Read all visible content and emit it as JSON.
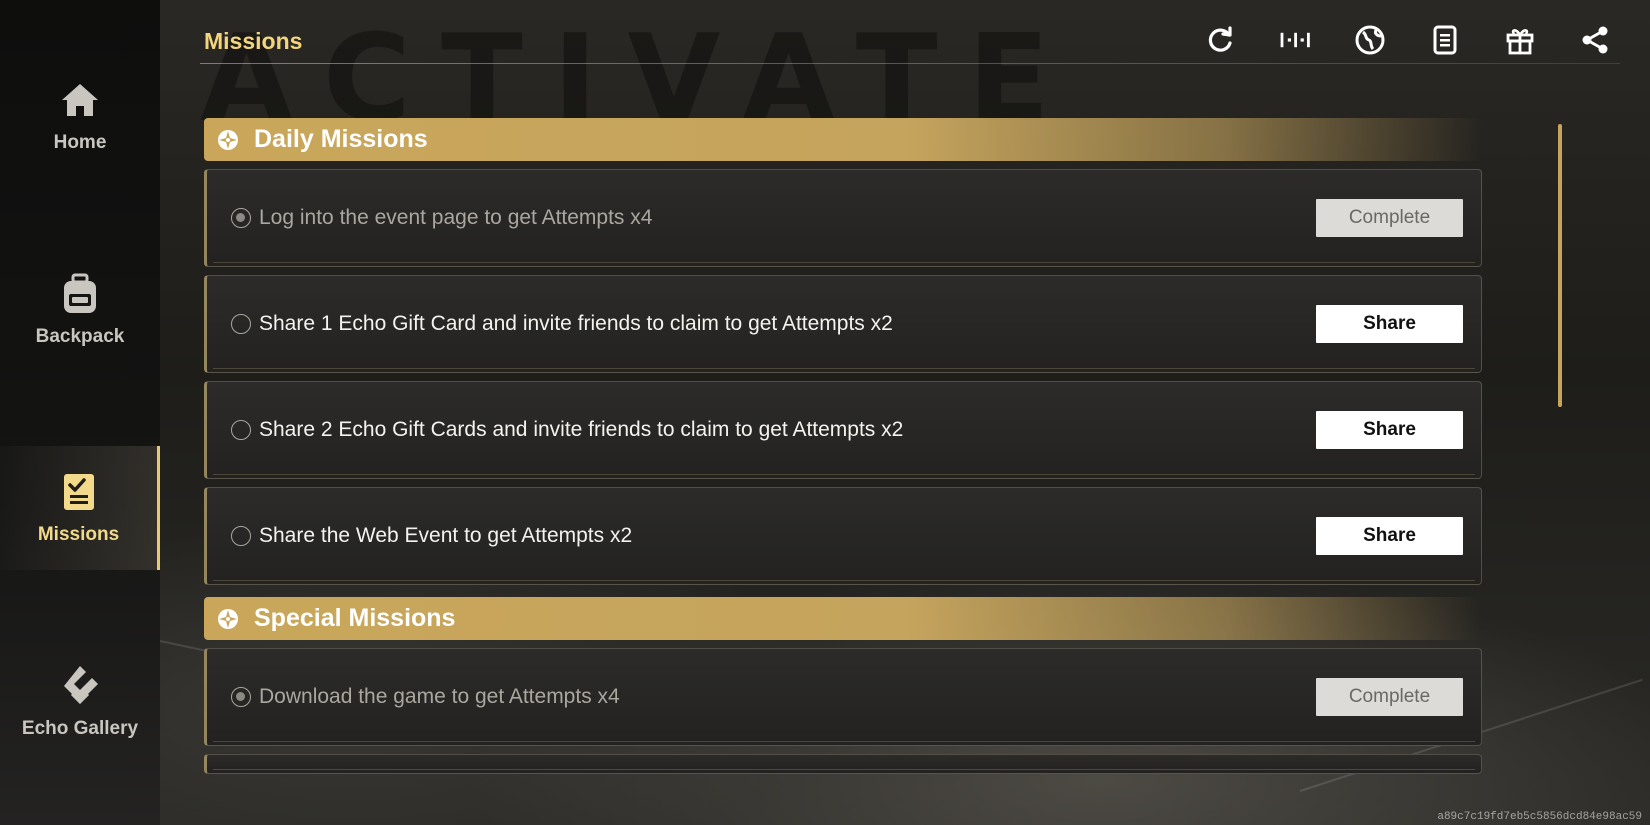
{
  "header": {
    "title": "Missions"
  },
  "toolbar": [
    {
      "icon": "refresh-icon"
    },
    {
      "icon": "progress-dots-icon"
    },
    {
      "icon": "globe-icon"
    },
    {
      "icon": "notes-icon"
    },
    {
      "icon": "gift-icon"
    },
    {
      "icon": "share-icon"
    }
  ],
  "sidebar": {
    "items": [
      {
        "label": "Home",
        "icon": "home-icon",
        "active": false
      },
      {
        "label": "Backpack",
        "icon": "backpack-icon",
        "active": false
      },
      {
        "label": "Missions",
        "icon": "missions-clipboard-icon",
        "active": true
      },
      {
        "label": "Echo Gallery",
        "icon": "echo-gallery-icon",
        "active": false
      }
    ]
  },
  "sections": [
    {
      "title": "Daily Missions",
      "missions": [
        {
          "text": "Log into the event page to get Attempts x4",
          "button": "Complete",
          "done": true
        },
        {
          "text": "Share 1 Echo Gift Card and invite friends to claim to get Attempts x2",
          "button": "Share",
          "done": false
        },
        {
          "text": "Share 2 Echo Gift Cards and invite friends to claim to get Attempts x2",
          "button": "Share",
          "done": false
        },
        {
          "text": "Share the Web Event to get Attempts x2",
          "button": "Share",
          "done": false
        }
      ]
    },
    {
      "title": "Special Missions",
      "missions": [
        {
          "text": "Download the game to get Attempts x4",
          "button": "Complete",
          "done": true
        }
      ]
    }
  ],
  "watermark": "a89c7c19fd7eb5c5856dcd84e98ac59",
  "colors": {
    "accent": "#f3d67c",
    "section_bar": "#c9a65a",
    "background": "#1b1a18"
  }
}
